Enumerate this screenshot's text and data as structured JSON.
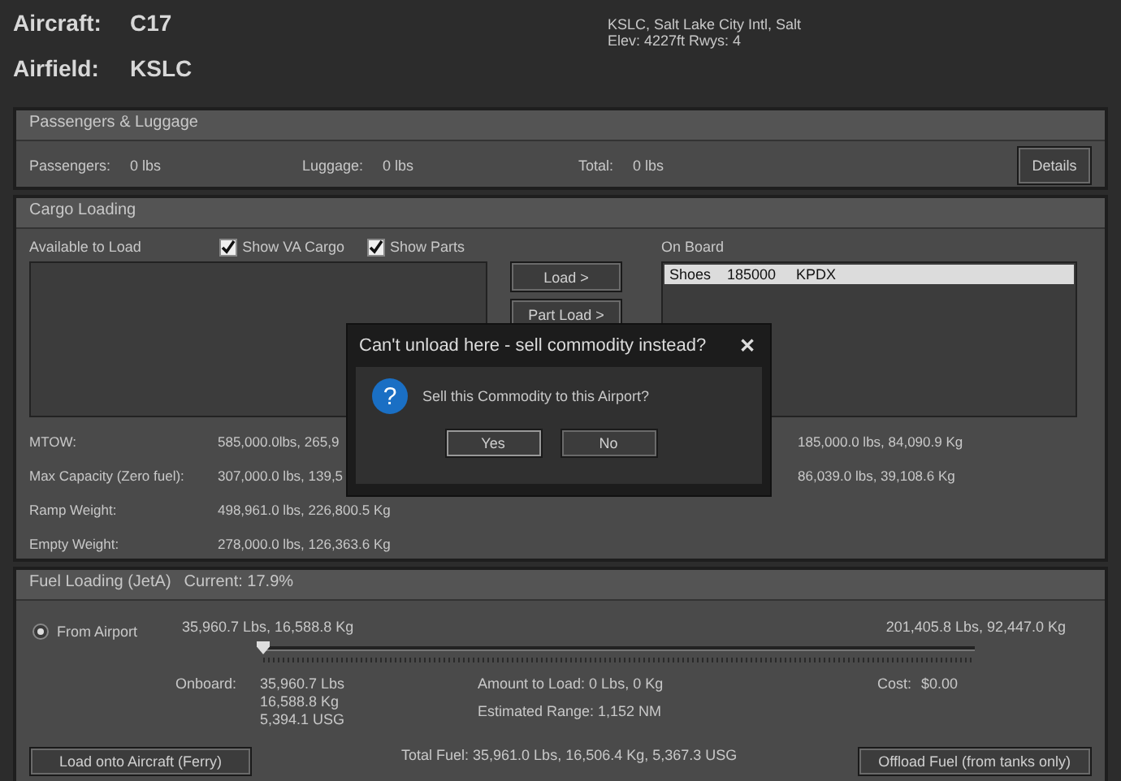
{
  "header": {
    "aircraft_label": "Aircraft:",
    "aircraft": "C17",
    "airfield_label": "Airfield:",
    "airfield": "KSLC",
    "airport_name": "KSLC, Salt Lake City Intl, Salt",
    "airport_info": "Elev: 4227ft Rwys: 4"
  },
  "passengers": {
    "title": "Passengers & Luggage",
    "fields": [
      {
        "label": "Passengers:",
        "value": "0 lbs"
      },
      {
        "label": "Luggage:",
        "value": "0 lbs"
      },
      {
        "label": "Total:",
        "value": "0 lbs"
      }
    ],
    "button": "Details"
  },
  "cargo": {
    "title": "Cargo Loading",
    "available_label": "Available to Load",
    "filters": [
      {
        "label": "Show VA Cargo",
        "checked": true
      },
      {
        "label": "Show Parts",
        "checked": true
      }
    ],
    "buttons": [
      "Load >",
      "Part Load >"
    ],
    "on_board_label": "On Board",
    "on_board": [
      {
        "name": "Shoes",
        "amount": "185000",
        "dest": "KPDX",
        "selected": true
      }
    ],
    "weights": [
      {
        "label": "MTOW:",
        "value": "585,000.0lbs, 265,9",
        "value_2": "185,000.0 lbs, 84,090.9 Kg"
      },
      {
        "label": "Max Capacity (Zero fuel):",
        "value": "307,000.0 lbs, 139,5",
        "value_2": "86,039.0 lbs, 39,108.6 Kg"
      },
      {
        "label": "Ramp Weight:",
        "value": "498,961.0 lbs, 226,800.5 Kg"
      },
      {
        "label": "Empty Weight:",
        "value": "278,000.0 lbs, 126,363.6 Kg"
      }
    ]
  },
  "fuel": {
    "title": "Fuel Loading (JetA)",
    "current": "Current: 17.9%",
    "source": {
      "label": "From Airport",
      "selected": true
    },
    "min": "35,960.7 Lbs, 16,588.8 Kg",
    "max": "201,405.8 Lbs, 92,447.0 Kg",
    "level": 0,
    "onboard_label": "Onboard:",
    "onboard": [
      "35,960.7 Lbs",
      "16,588.8 Kg",
      "5,394.1 USG"
    ],
    "amount": "Amount to Load: 0 Lbs, 0 Kg",
    "range": "Estimated Range: 1,152 NM",
    "total": "Total Fuel: 35,961.0 Lbs, 16,506.4 Kg, 5,367.3 USG",
    "cost_label": "Cost:",
    "cost": "$0.00",
    "buttons": [
      "Load onto Aircraft (Ferry)",
      "Offload Fuel (from tanks only)"
    ]
  },
  "dialog": {
    "title": "Can't unload here - sell commodity instead?",
    "close": "✕",
    "icon": "?",
    "message": "Sell this Commodity to this Airport?",
    "buttons": [
      "Yes",
      "No"
    ]
  }
}
